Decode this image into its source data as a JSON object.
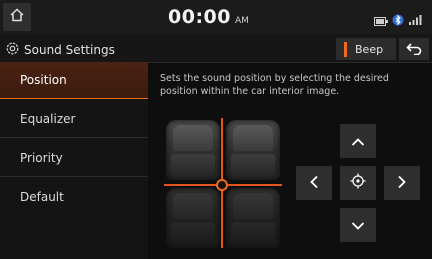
{
  "status_bar": {
    "time": "00:00",
    "ampm": "AM",
    "icons": [
      "home-icon",
      "battery-icon",
      "bluetooth-icon",
      "signal-icon"
    ]
  },
  "header": {
    "title": "Sound Settings",
    "title_icon": "gear-icon",
    "beep_label": "Beep",
    "back_icon": "back-arrow-icon"
  },
  "sidebar": {
    "items": [
      {
        "label": "Position",
        "active": true
      },
      {
        "label": "Equalizer",
        "active": false
      },
      {
        "label": "Priority",
        "active": false
      },
      {
        "label": "Default",
        "active": false
      }
    ]
  },
  "main": {
    "description": "Sets the sound position by selecting the desired position within the car interior image."
  },
  "colors": {
    "accent": "#f06a1e",
    "background": "#0e0e0e",
    "button": "#2e2e2e"
  }
}
